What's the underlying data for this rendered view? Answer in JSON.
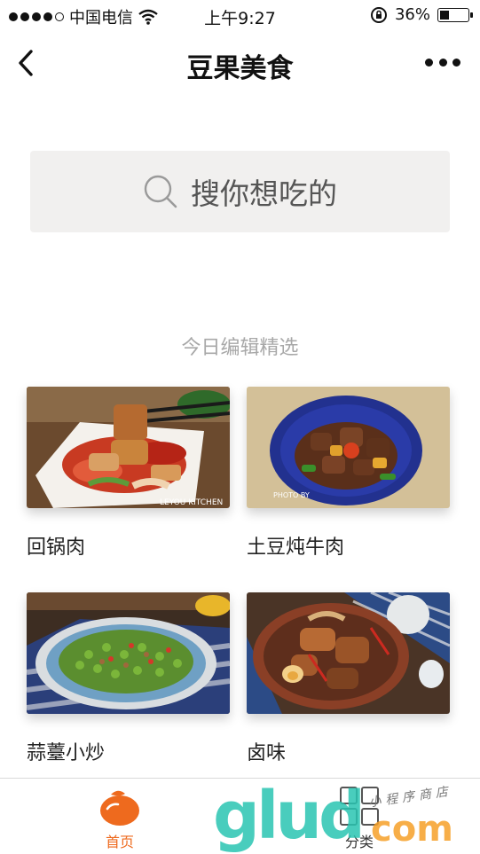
{
  "status_bar": {
    "carrier": "中国电信",
    "time": "上午9:27",
    "battery_percent": "36%",
    "battery_level": 0.36,
    "signal_bars_filled": 4,
    "signal_bars_total": 5
  },
  "nav": {
    "title": "豆果美食",
    "back_icon": "chevron-left-icon",
    "more_icon": "more-dots-icon"
  },
  "search": {
    "placeholder": "搜你想吃的",
    "icon": "search-icon"
  },
  "section": {
    "title": "今日编辑精选"
  },
  "recipes": [
    {
      "name": "回锅肉"
    },
    {
      "name": "土豆炖牛肉"
    },
    {
      "name": "蒜薹小炒"
    },
    {
      "name": "卤味"
    }
  ],
  "image_captions": {
    "recipe1": "LEYOU KITCHEN",
    "recipe2": "PHOTO BY"
  },
  "tab_bar": {
    "home": {
      "label": "首页",
      "icon": "home-icon",
      "color": "#ee6a1e"
    },
    "category": {
      "label": "分类",
      "icon": "grid-icon"
    }
  },
  "watermark": {
    "brand": "glud",
    "suffix": "com",
    "subtitle": "小程序商店"
  },
  "colors": {
    "accent": "#ee6a1e",
    "search_bg": "#f1f0ef",
    "section_title": "#a8a8a8"
  }
}
